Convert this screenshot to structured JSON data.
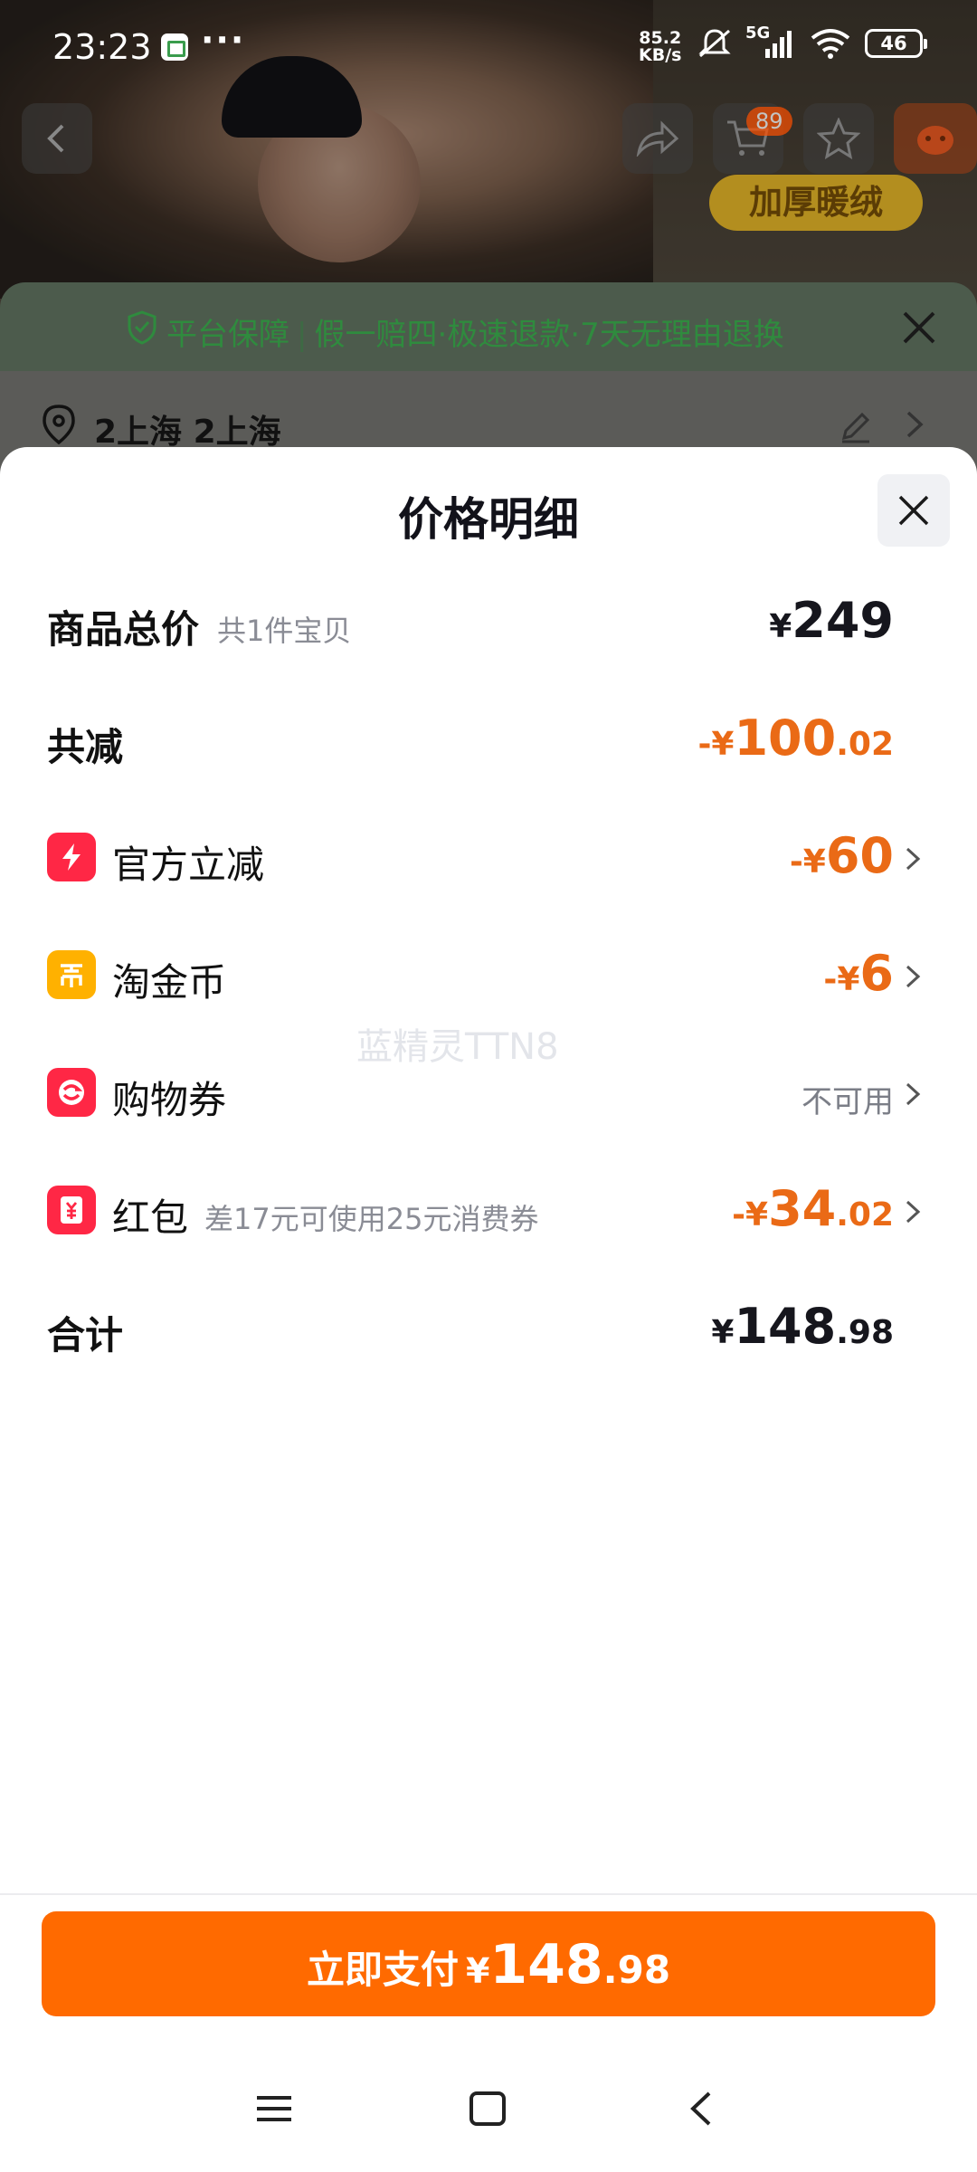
{
  "status_bar": {
    "time": "23:23",
    "dots": "···",
    "net_speed_value": "85.2",
    "net_speed_unit": "KB/s",
    "network": "5G",
    "battery": "46"
  },
  "background_page": {
    "cart_badge": "89",
    "warm_tag": "加厚暖绒",
    "guarantee": {
      "title": "平台保障",
      "items": "假一赔四·极速退款·7天无理由退换"
    },
    "address": "2上海 2上海"
  },
  "sheet": {
    "title": "价格明细",
    "rows": {
      "subtotal": {
        "label": "商品总价",
        "sub": "共1件宝贝",
        "yen": "¥",
        "int": "249",
        "dec": ""
      },
      "reduce": {
        "label": "共减",
        "yen": "-¥",
        "int": "100",
        "dec": ".02"
      },
      "official": {
        "label": "官方立减",
        "yen": "-¥",
        "int": "60",
        "dec": ""
      },
      "coins": {
        "label": "淘金币",
        "yen": "-¥",
        "int": "6",
        "dec": ""
      },
      "coupon": {
        "label": "购物券",
        "status": "不可用"
      },
      "redpacket": {
        "label": "红包",
        "sub": "差17元可使用25元消费券",
        "yen": "-¥",
        "int": "34",
        "dec": ".02"
      },
      "total": {
        "label": "合计",
        "yen": "¥",
        "int": "148",
        "dec": ".98"
      }
    },
    "watermark": "蓝精灵TTN8"
  },
  "pay_button": {
    "label": "立即支付",
    "yen": "¥",
    "int": "148",
    "dec": ".98"
  },
  "colors": {
    "accent_orange": "#ff6a00",
    "discount_orange": "#ea6a16",
    "badge_red": "#ff2745",
    "coin_yellow": "#ffb100"
  }
}
